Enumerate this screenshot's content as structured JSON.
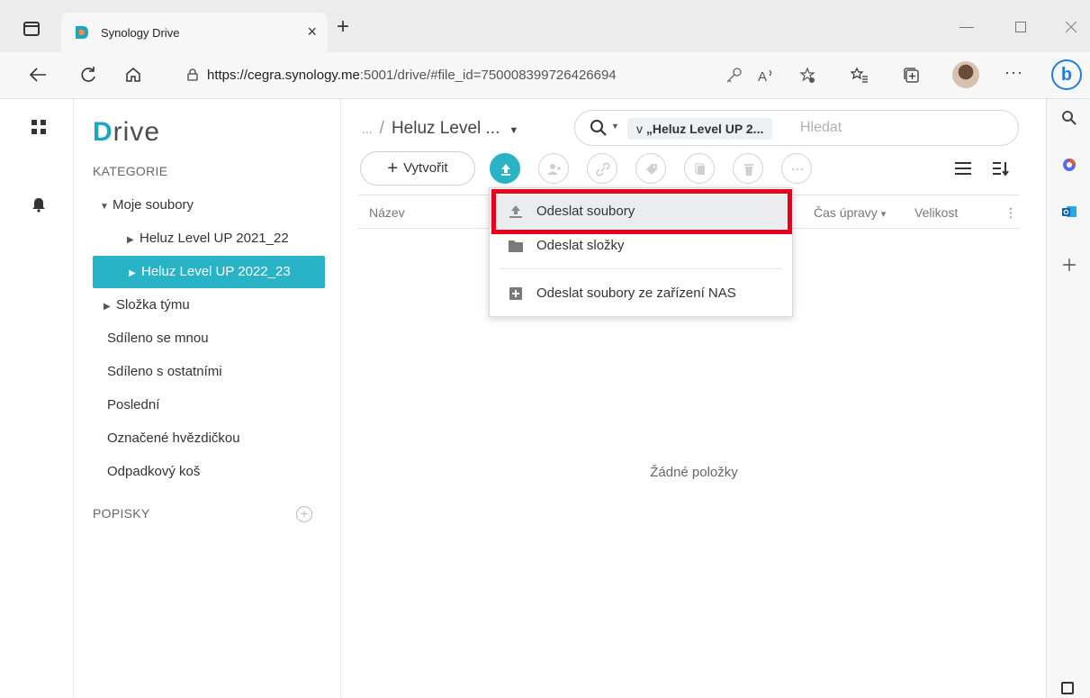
{
  "browser": {
    "tab_title": "Synology Drive",
    "tab_close": "×",
    "new_tab": "+",
    "url_host": "https://cegra.synology.me",
    "url_rest": ":5001/drive/#file_id=750008399726426694",
    "more": "···",
    "bing": "b",
    "accent": "#1d7fe0"
  },
  "sidebar": {
    "logo_first": "D",
    "logo_rest": "rive",
    "categories_heading": "KATEGORIE",
    "items": [
      {
        "label": "Moje soubory",
        "caret": "▼"
      },
      {
        "label": "Heluz Level UP 2021_22",
        "caret": "▶"
      },
      {
        "label": "Heluz Level UP 2022_23",
        "caret": "▶"
      },
      {
        "label": "Složka týmu",
        "caret": "▶"
      },
      {
        "label": "Sdíleno se mnou"
      },
      {
        "label": "Sdíleno s ostatními"
      },
      {
        "label": "Poslední"
      },
      {
        "label": "Označené hvězdičkou"
      },
      {
        "label": "Odpadkový koš"
      }
    ],
    "tags_heading": "POPISKY",
    "add_tag": "+",
    "accent": "#29b3c6"
  },
  "main": {
    "breadcrumb_dots": "...",
    "breadcrumb_sep": "/",
    "breadcrumb_current": "Heluz Level ...",
    "breadcrumb_dd": "▼",
    "search_scope_prefix": "v",
    "search_scope": "„Heluz Level UP 2...",
    "search_placeholder": "Hledat",
    "search_dd": "▼",
    "create_plus": "+",
    "create_label": "Vytvořit",
    "columns": {
      "name": "Název",
      "modified": "Čas úpravy",
      "modified_sort": "▾",
      "size": "Velikost",
      "more": "⋮"
    },
    "empty_text": "Žádné položky"
  },
  "upload_menu": {
    "items": [
      {
        "label": "Odeslat soubory"
      },
      {
        "label": "Odeslat složky"
      },
      {
        "label": "Odeslat soubory ze zařízení NAS"
      }
    ],
    "highlight_color": "#e8001c"
  }
}
